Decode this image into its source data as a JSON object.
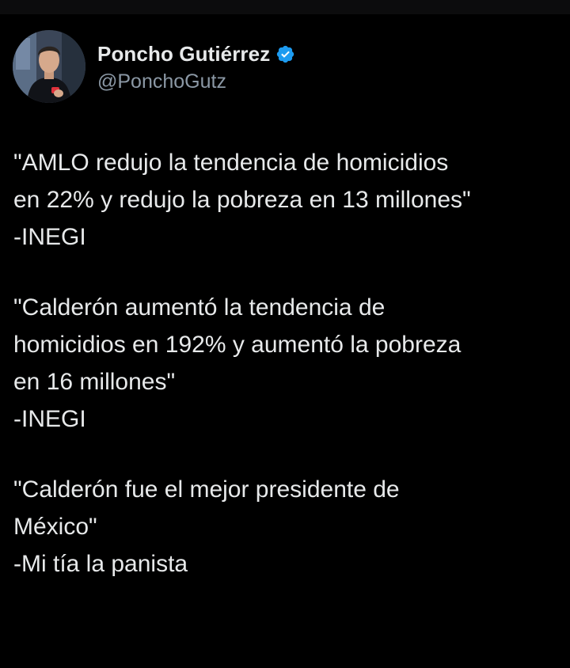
{
  "app": {
    "colors": {
      "background": "#000000",
      "text": "#e7e9ea",
      "secondary_text": "#8b98a5",
      "verified_badge": "#1d9bf0"
    }
  },
  "author": {
    "display_name": "Poncho Gutiérrez",
    "handle": "@PonchoGutz",
    "verified": true,
    "avatar_icon": "profile-photo",
    "badge_icon": "verified-badge-icon"
  },
  "tweet": {
    "paragraphs": [
      {
        "lines": [
          "\"AMLO redujo la tendencia de homicidios",
          "en 22% y redujo la pobreza en 13 millones\"",
          "-INEGI"
        ]
      },
      {
        "lines": [
          "\"Calderón aumentó la tendencia de",
          "homicidios en 192% y aumentó la pobreza",
          "en 16 millones\"",
          "-INEGI"
        ]
      },
      {
        "lines": [
          "\"Calderón fue el mejor presidente de",
          "México\"",
          "-Mi tía la panista"
        ]
      }
    ]
  }
}
